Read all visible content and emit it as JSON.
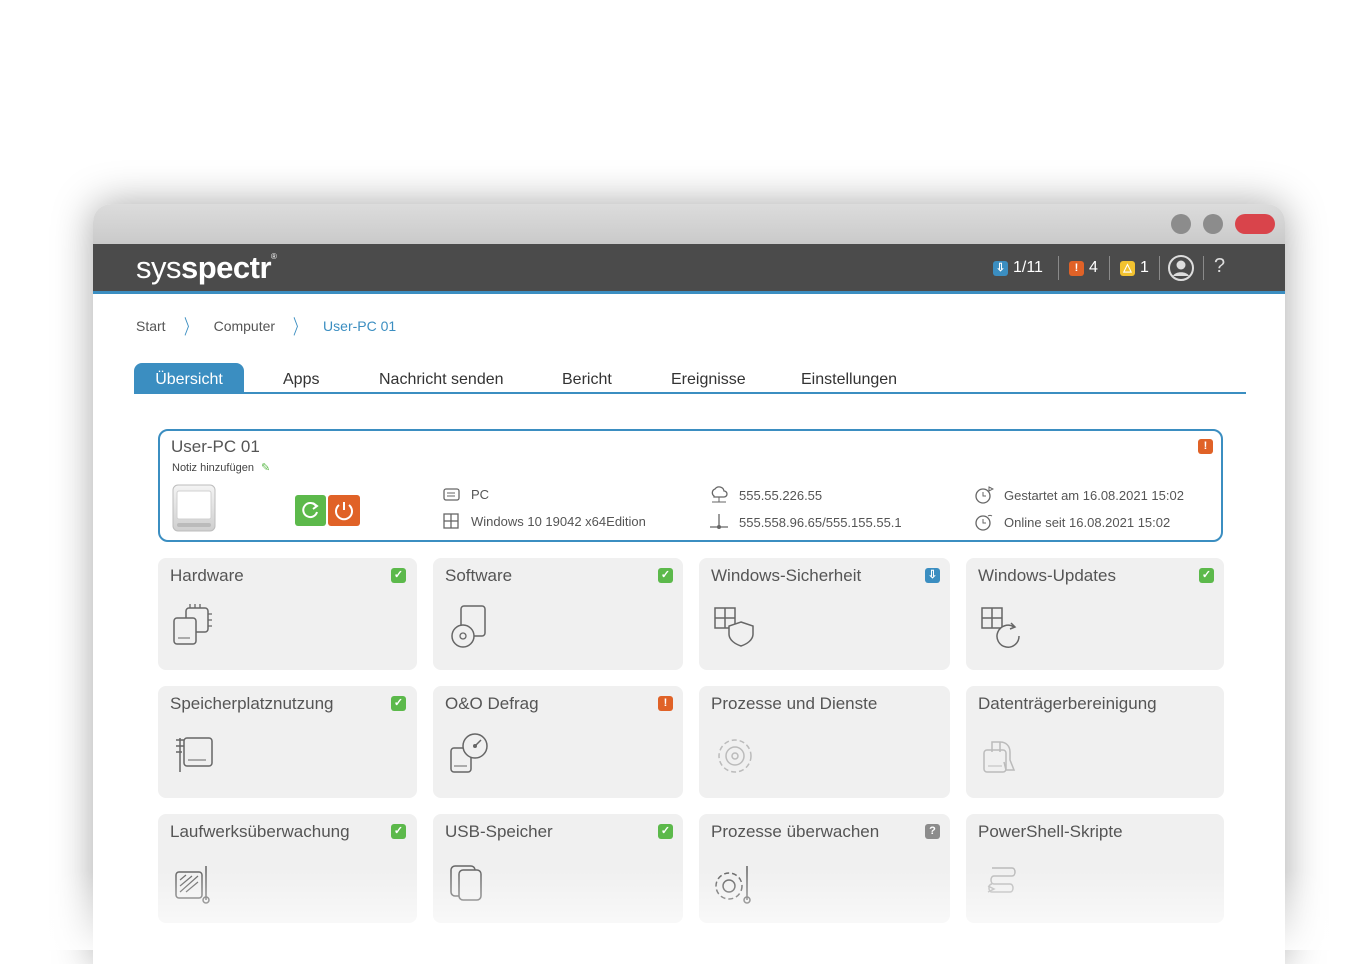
{
  "brand": {
    "logo_light": "sys",
    "logo_bold": "spectr",
    "logo_mark": "®"
  },
  "status": {
    "updates": "1/11",
    "errors": "4",
    "warnings": "1",
    "help": "?"
  },
  "breadcrumb": {
    "items": [
      "Start",
      "Computer",
      "User-PC 01"
    ]
  },
  "tabs": [
    "Übersicht",
    "Apps",
    "Nachricht senden",
    "Bericht",
    "Ereignisse",
    "Einstellungen"
  ],
  "device": {
    "name": "User-PC 01",
    "note": "Notiz hinzufügen",
    "type": "PC",
    "os": "Windows 10 19042 x64Edition",
    "public_ip": "555.55.226.55",
    "local_ip": "555.558.96.65/555.155.55.1",
    "started": "Gestartet am 16.08.2021 15:02",
    "online": "Online seit 16.08.2021 15:02",
    "status_badge": "!"
  },
  "tiles": [
    {
      "title": "Hardware",
      "status": "ok",
      "icon": "hardware-icon"
    },
    {
      "title": "Software",
      "status": "ok",
      "icon": "software-icon"
    },
    {
      "title": "Windows-Sicherheit",
      "status": "info",
      "icon": "windows-security-icon"
    },
    {
      "title": "Windows-Updates",
      "status": "ok",
      "icon": "windows-updates-icon"
    },
    {
      "title": "Speicherplatznutzung",
      "status": "ok",
      "icon": "storage-usage-icon"
    },
    {
      "title": "O&O Defrag",
      "status": "error",
      "icon": "defrag-icon"
    },
    {
      "title": "Prozesse und Dienste",
      "status": "none",
      "icon": "processes-icon"
    },
    {
      "title": "Datenträgerbereinigung",
      "status": "none",
      "icon": "disk-cleanup-icon"
    },
    {
      "title": "Laufwerksüberwachung",
      "status": "ok",
      "icon": "drive-monitoring-icon"
    },
    {
      "title": "USB-Speicher",
      "status": "ok",
      "icon": "usb-storage-icon"
    },
    {
      "title": "Prozesse überwachen",
      "status": "unknown",
      "icon": "process-monitor-icon"
    },
    {
      "title": "PowerShell-Skripte",
      "status": "none",
      "icon": "powershell-icon"
    }
  ],
  "colors": {
    "accent": "#3b8ec1",
    "ok": "#5cb94b",
    "error": "#e06227",
    "warning": "#f2c230",
    "appbar": "#4b4b4b"
  }
}
